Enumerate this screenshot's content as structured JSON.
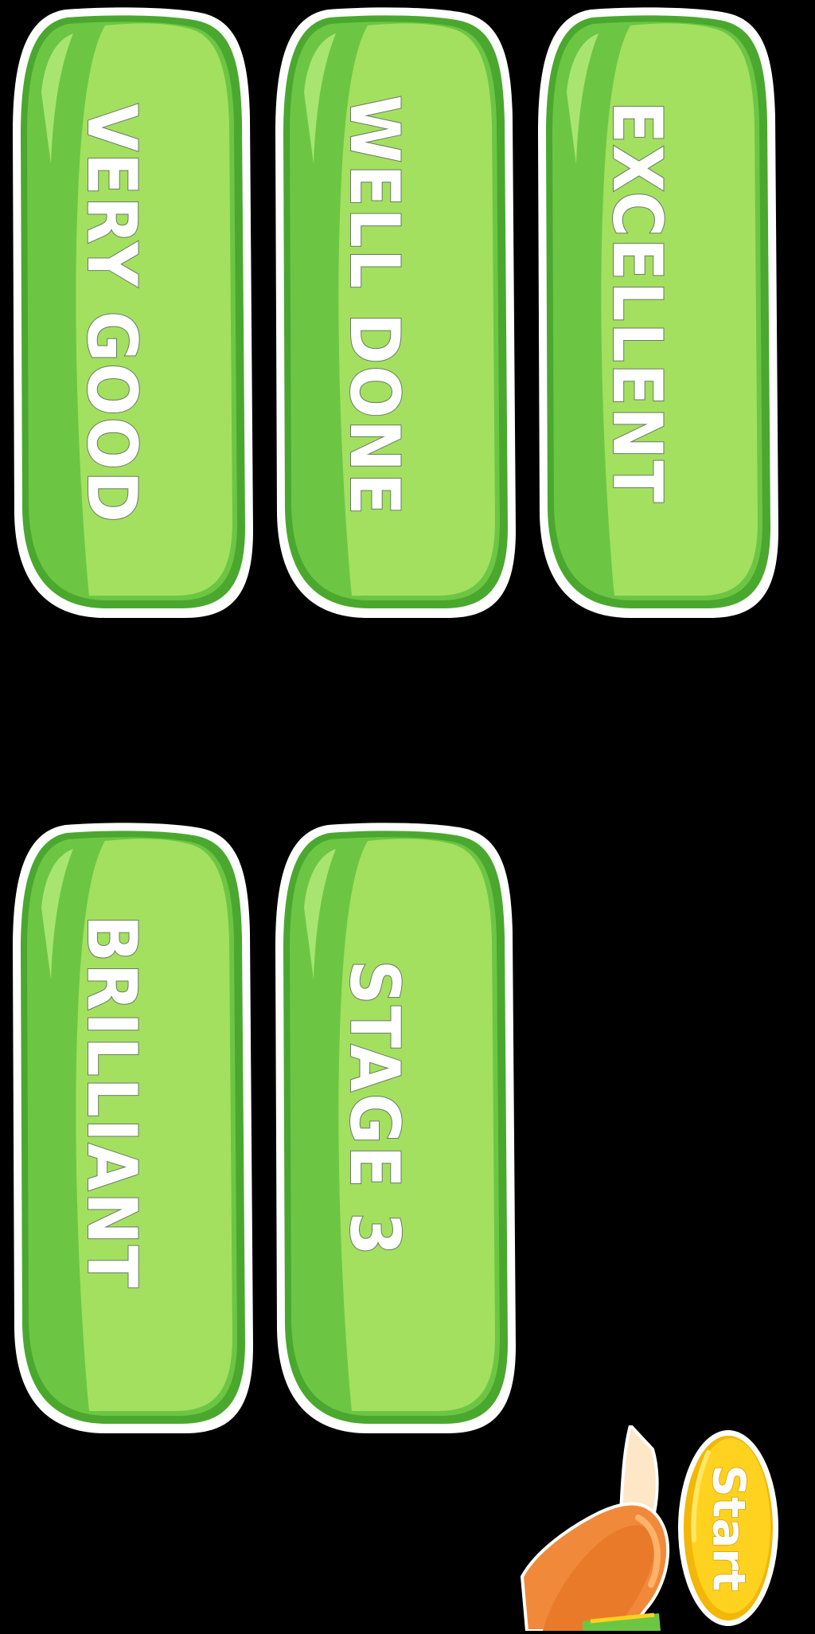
{
  "buttons": [
    {
      "id": "very-good",
      "label": "VERY GOOD"
    },
    {
      "id": "well-done",
      "label": "WELL DONE"
    },
    {
      "id": "excellent",
      "label": "EXCELLENT"
    },
    {
      "id": "brilliant",
      "label": "BRILLIANT"
    },
    {
      "id": "stage-3",
      "label": "STAGE 3"
    }
  ],
  "start": {
    "label": "Start"
  },
  "colors": {
    "background": "#000000",
    "pill_light": "#a3e060",
    "pill_mid": "#6cc644",
    "pill_dark": "#4aa82e",
    "pill_outline": "#ffffff",
    "start_yellow": "#ffd21f",
    "hand_orange": "#f08a3a"
  }
}
